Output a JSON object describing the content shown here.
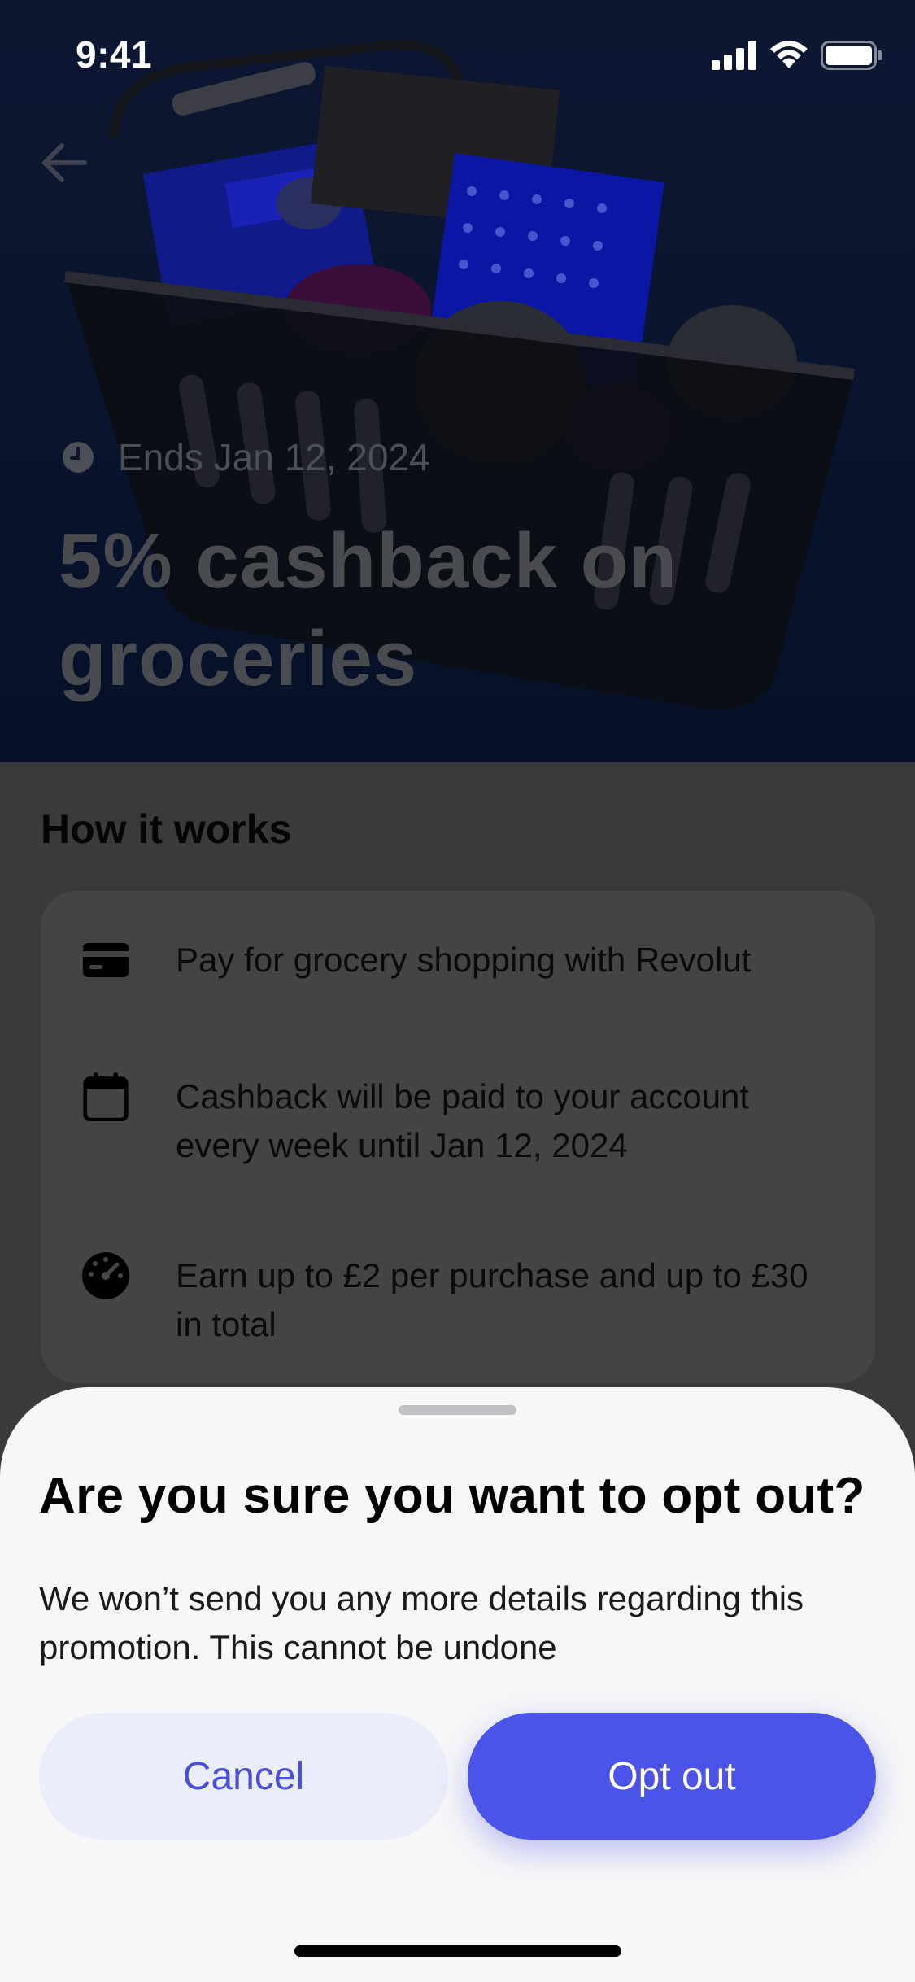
{
  "status_bar": {
    "time": "9:41"
  },
  "hero": {
    "ends_label": "Ends Jan 12, 2024",
    "title": "5% cashback on groceries"
  },
  "how_it_works": {
    "title": "How it works",
    "items": [
      {
        "icon": "card-icon",
        "text": "Pay for grocery shopping with Revolut"
      },
      {
        "icon": "calendar-icon",
        "text": "Cashback will be paid to your account every week until Jan 12, 2024"
      },
      {
        "icon": "gauge-icon",
        "text": "Earn up to £2 per purchase and up to £30 in total"
      }
    ]
  },
  "sheet": {
    "title": "Are you sure you want to opt out?",
    "description": "We won’t send you any more details regarding this promotion. This cannot be undone",
    "cancel_label": "Cancel",
    "optout_label": "Opt out"
  },
  "colors": {
    "accent": "#4c53ea",
    "cancel_bg": "#ebedfb",
    "hero_bg": "#0b1530"
  }
}
